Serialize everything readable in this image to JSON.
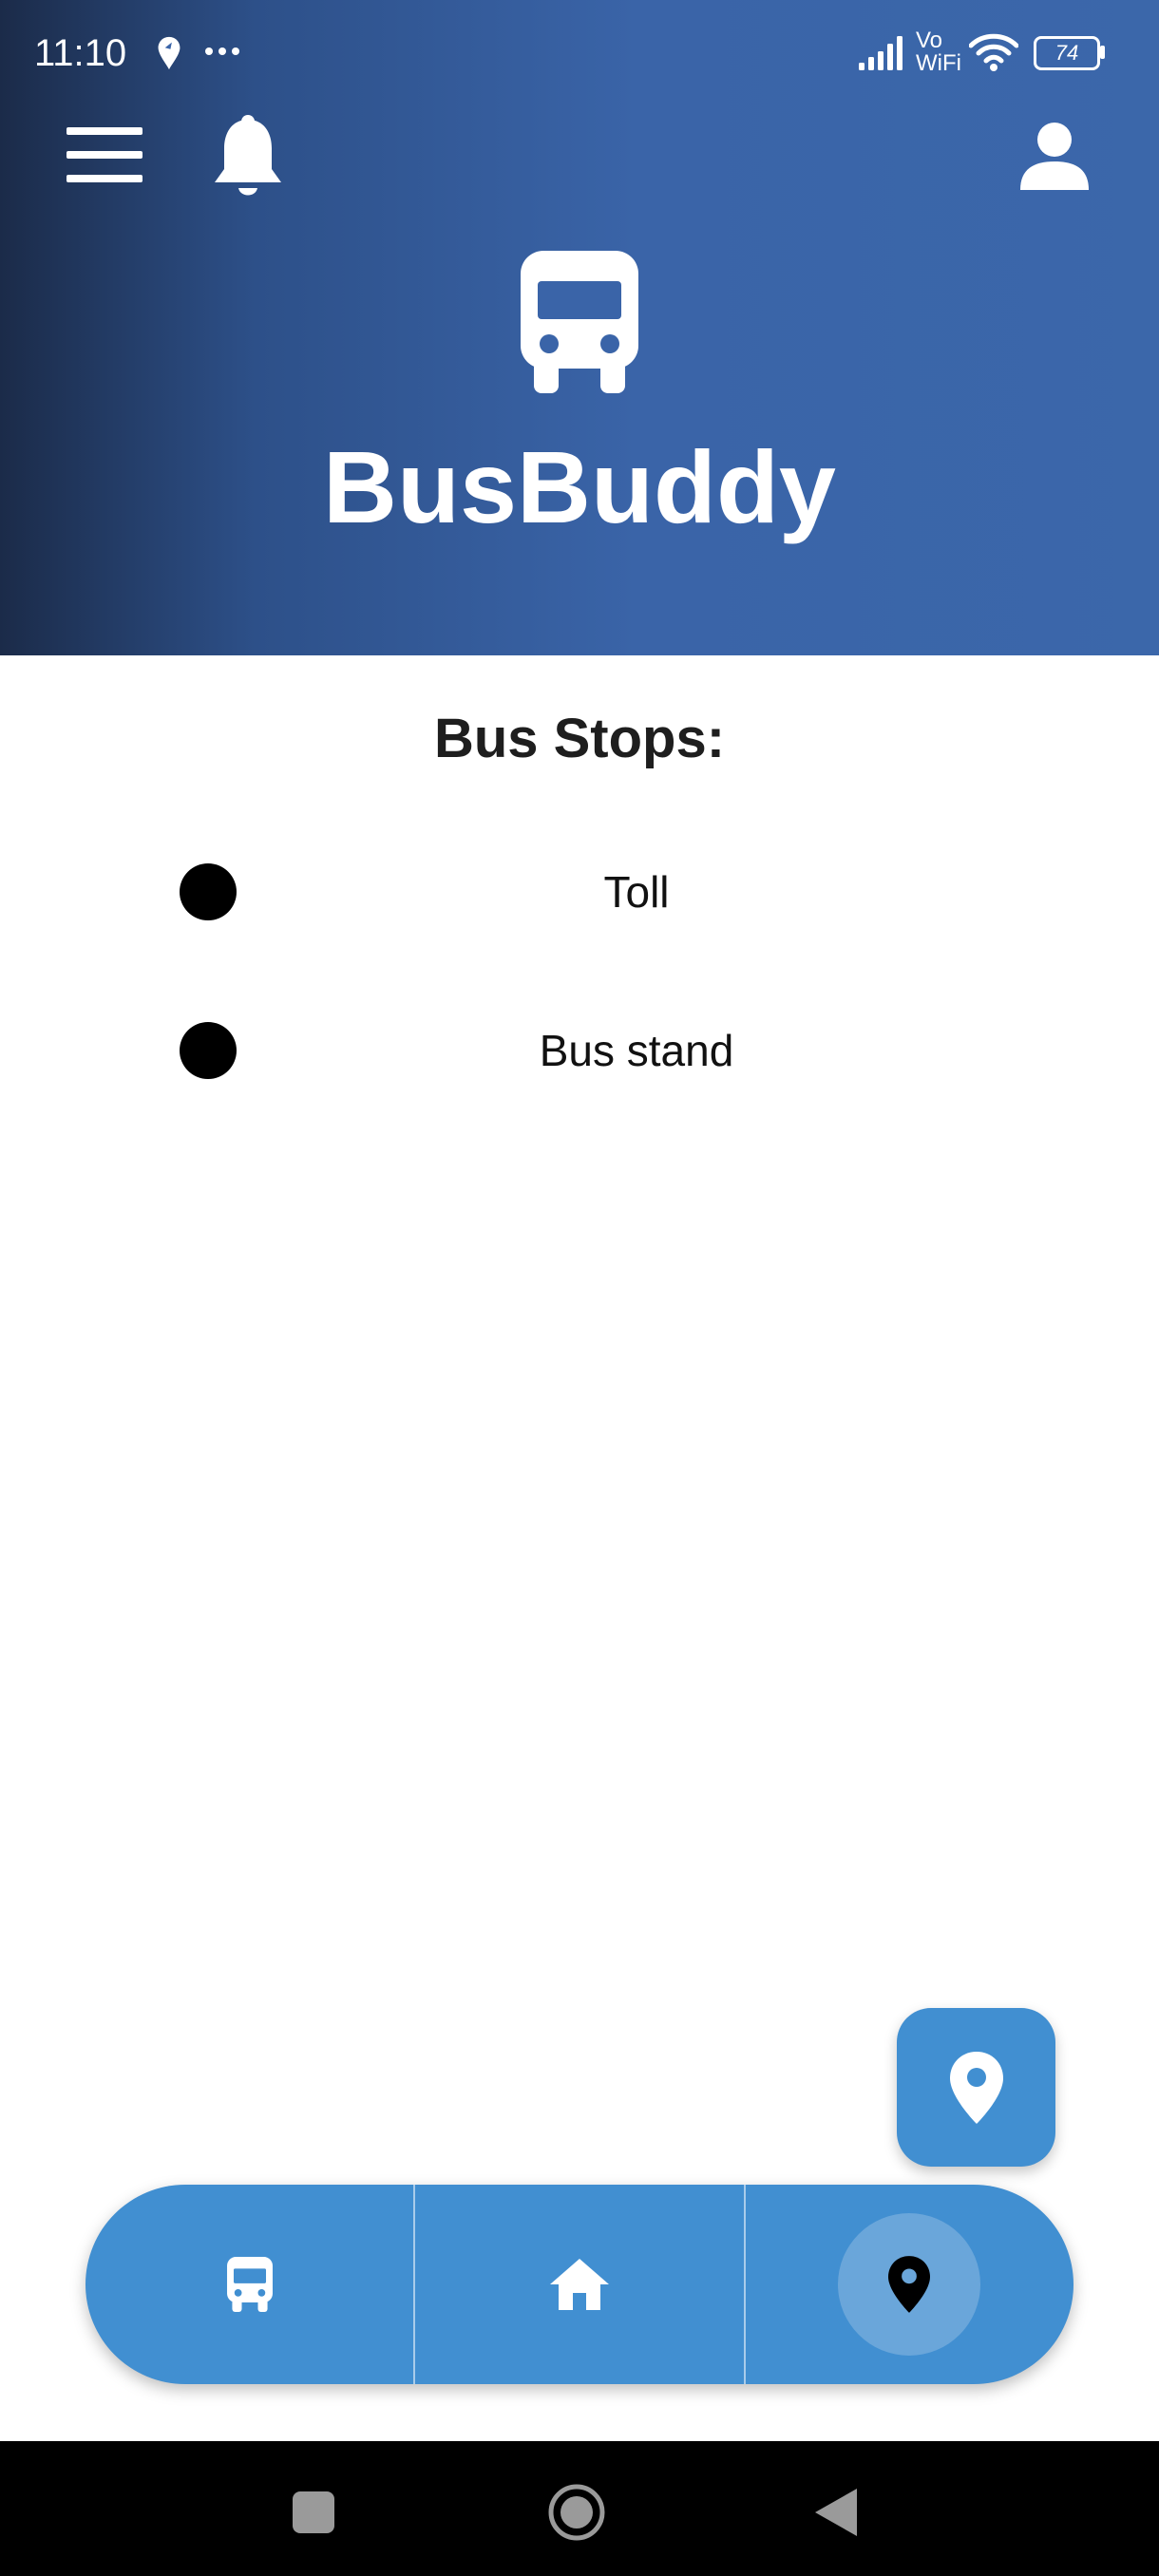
{
  "status_bar": {
    "time": "11:10",
    "network_label_top": "Vo",
    "network_label_bottom": "WiFi",
    "battery_percent": "74"
  },
  "header": {
    "app_title": "BusBuddy",
    "icons": [
      "menu-icon",
      "bell-icon",
      "user-icon",
      "bus-icon"
    ],
    "background_gradient": [
      "#1b2b49",
      "#3b67aa"
    ]
  },
  "main": {
    "heading": "Bus Stops:",
    "stops": [
      {
        "label": "Toll"
      },
      {
        "label": "Bus stand"
      }
    ]
  },
  "fab": {
    "icon": "location-pin-icon"
  },
  "bottom_nav": {
    "items": [
      {
        "icon": "bus-icon",
        "active": false
      },
      {
        "icon": "home-icon",
        "active": false
      },
      {
        "icon": "location-pin-icon",
        "active": true
      }
    ]
  },
  "system_nav": {
    "buttons": [
      "recents-button",
      "home-button",
      "back-button"
    ]
  },
  "colors": {
    "accent": "#418fd1",
    "active_tab_highlight": "#6aa6da",
    "header_blue": "#3b67aa",
    "header_dark": "#1b2b49"
  }
}
